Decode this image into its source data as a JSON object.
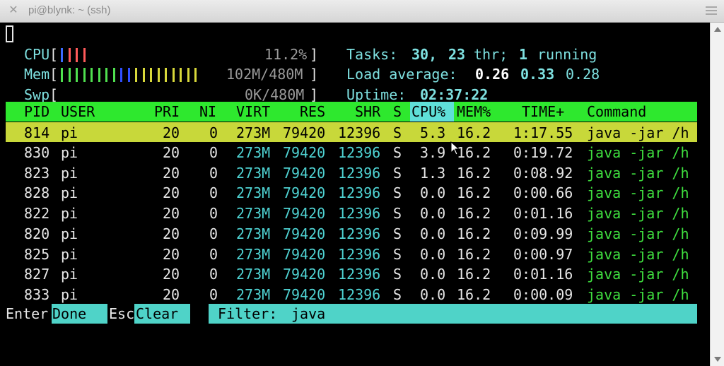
{
  "window": {
    "title": "pi@blynk: ~ (ssh)"
  },
  "meters": {
    "cpu": {
      "label": "CPU",
      "value": "11.2%",
      "bars": [
        "#3b6bff",
        "#ff5a5a",
        "#ff5a5a",
        "#ff5a5a"
      ]
    },
    "mem": {
      "label": "Mem",
      "value": "102M/480M",
      "bars": [
        "#4fe04f",
        "#4fe04f",
        "#4fe04f",
        "#4fe04f",
        "#4fe04f",
        "#4fe04f",
        "#4fe04f",
        "#4fe04f",
        "#2f4fff",
        "#2f4fff",
        "#d8d83a",
        "#d8d83a",
        "#d8d83a",
        "#d8d83a",
        "#d8d83a",
        "#d8d83a",
        "#d8d83a",
        "#d8d83a",
        "#d8d83a"
      ]
    },
    "swp": {
      "label": "Swp",
      "value": "0K/480M"
    }
  },
  "summary": {
    "tasks_label": "Tasks:",
    "tasks_count": "30,",
    "threads": "23",
    "thr_label": "thr;",
    "running_count": "1",
    "running_label": "running",
    "load_label": "Load average:",
    "load1": "0.26",
    "load5": "0.33",
    "load15": "0.28",
    "uptime_label": "Uptime:",
    "uptime": "02:37:22"
  },
  "columns": {
    "pid": "PID",
    "user": "USER",
    "pri": "PRI",
    "ni": "NI",
    "virt": "VIRT",
    "res": "RES",
    "shr": "SHR",
    "s": "S",
    "cpu": "CPU%",
    "mem": "MEM%",
    "time": "TIME+",
    "cmd": "Command"
  },
  "processes": [
    {
      "pid": "814",
      "user": "pi",
      "pri": "20",
      "ni": "0",
      "virt": "273M",
      "res": "79420",
      "shr": "12396",
      "s": "S",
      "cpu": "5.3",
      "mem": "16.2",
      "time": "1:17.55",
      "cmd": "java -jar /h"
    },
    {
      "pid": "830",
      "user": "pi",
      "pri": "20",
      "ni": "0",
      "virt": "273M",
      "res": "79420",
      "shr": "12396",
      "s": "S",
      "cpu": "3.9",
      "mem": "16.2",
      "time": "0:19.72",
      "cmd": "java -jar /h"
    },
    {
      "pid": "823",
      "user": "pi",
      "pri": "20",
      "ni": "0",
      "virt": "273M",
      "res": "79420",
      "shr": "12396",
      "s": "S",
      "cpu": "1.3",
      "mem": "16.2",
      "time": "0:08.92",
      "cmd": "java -jar /h"
    },
    {
      "pid": "828",
      "user": "pi",
      "pri": "20",
      "ni": "0",
      "virt": "273M",
      "res": "79420",
      "shr": "12396",
      "s": "S",
      "cpu": "0.0",
      "mem": "16.2",
      "time": "0:00.66",
      "cmd": "java -jar /h"
    },
    {
      "pid": "822",
      "user": "pi",
      "pri": "20",
      "ni": "0",
      "virt": "273M",
      "res": "79420",
      "shr": "12396",
      "s": "S",
      "cpu": "0.0",
      "mem": "16.2",
      "time": "0:01.16",
      "cmd": "java -jar /h"
    },
    {
      "pid": "820",
      "user": "pi",
      "pri": "20",
      "ni": "0",
      "virt": "273M",
      "res": "79420",
      "shr": "12396",
      "s": "S",
      "cpu": "0.0",
      "mem": "16.2",
      "time": "0:09.99",
      "cmd": "java -jar /h"
    },
    {
      "pid": "825",
      "user": "pi",
      "pri": "20",
      "ni": "0",
      "virt": "273M",
      "res": "79420",
      "shr": "12396",
      "s": "S",
      "cpu": "0.0",
      "mem": "16.2",
      "time": "0:00.97",
      "cmd": "java -jar /h"
    },
    {
      "pid": "827",
      "user": "pi",
      "pri": "20",
      "ni": "0",
      "virt": "273M",
      "res": "79420",
      "shr": "12396",
      "s": "S",
      "cpu": "0.0",
      "mem": "16.2",
      "time": "0:01.16",
      "cmd": "java -jar /h"
    },
    {
      "pid": "833",
      "user": "pi",
      "pri": "20",
      "ni": "0",
      "virt": "273M",
      "res": "79420",
      "shr": "12396",
      "s": "S",
      "cpu": "0.0",
      "mem": "16.2",
      "time": "0:00.09",
      "cmd": "java -jar /h"
    }
  ],
  "footer": {
    "enter_key": "Enter",
    "enter_label": "Done",
    "esc_key": "Esc",
    "esc_label": "Clear",
    "filter_label": "Filter:",
    "filter_value": "java"
  }
}
